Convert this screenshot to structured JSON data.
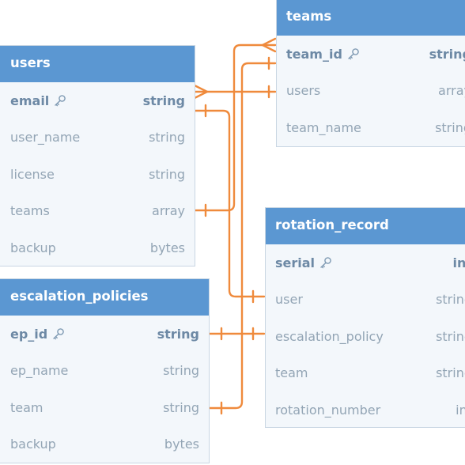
{
  "colors": {
    "header": "#5b97d2",
    "table_bg": "#f3f7fb",
    "border": "#c9d6e3",
    "connector": "#ef8a3c",
    "text_muted": "#93a5b5",
    "text_key": "#6d89a5"
  },
  "tables": {
    "users": {
      "title": "users",
      "fields": [
        {
          "name": "email",
          "type": "string",
          "key_icon": "key-icon"
        },
        {
          "name": "user_name",
          "type": "string"
        },
        {
          "name": "license",
          "type": "string"
        },
        {
          "name": "teams",
          "type": "array"
        },
        {
          "name": "backup",
          "type": "bytes"
        }
      ]
    },
    "teams": {
      "title": "teams",
      "fields": [
        {
          "name": "team_id",
          "type": "string",
          "key_icon": "key-icon"
        },
        {
          "name": "users",
          "type": "array"
        },
        {
          "name": "team_name",
          "type": "string"
        }
      ]
    },
    "escalation_policies": {
      "title": "escalation_policies",
      "fields": [
        {
          "name": "ep_id",
          "type": "string",
          "key_icon": "key-icon"
        },
        {
          "name": "ep_name",
          "type": "string"
        },
        {
          "name": "team",
          "type": "string"
        },
        {
          "name": "backup",
          "type": "bytes"
        }
      ]
    },
    "rotation_record": {
      "title": "rotation_record",
      "fields": [
        {
          "name": "serial",
          "type": "int",
          "key_icon": "key-icon"
        },
        {
          "name": "user",
          "type": "string"
        },
        {
          "name": "escalation_policy",
          "type": "string"
        },
        {
          "name": "team",
          "type": "string"
        },
        {
          "name": "rotation_number",
          "type": "int"
        }
      ]
    }
  }
}
